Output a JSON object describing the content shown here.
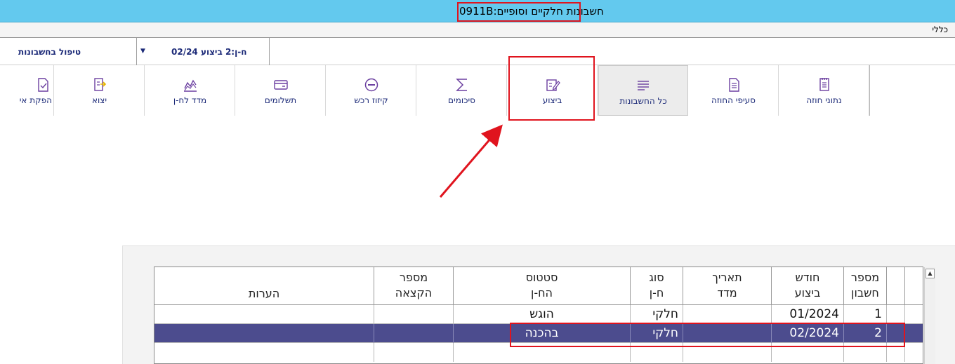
{
  "titlebar": {
    "title": "0911B:חשבונות חלקיים וסופיים"
  },
  "menu": {
    "general": "כללי"
  },
  "selector": {
    "handling_label": "טיפול בחשבונות",
    "current_value": "ח-ן:2 ביצוע 02/24"
  },
  "toolbar": {
    "buttons": [
      {
        "label": "נתוני חוזה",
        "icon": "contract-data-icon"
      },
      {
        "label": "סעיפי החוזה",
        "icon": "contract-sections-icon"
      },
      {
        "label": "כל החשבונות",
        "icon": "all-accounts-icon"
      },
      {
        "label": "ביצוע",
        "icon": "execution-icon"
      },
      {
        "label": "סיכומים",
        "icon": "sigma-icon"
      },
      {
        "label": "קיזוז רכש",
        "icon": "purchase-offset-icon"
      },
      {
        "label": "תשלומים",
        "icon": "payments-icon"
      },
      {
        "label": "מדד לח-ן",
        "icon": "index-chart-icon"
      },
      {
        "label": "יצוא",
        "icon": "export-icon"
      },
      {
        "label": "הפקת אי",
        "icon": "produce-icon"
      }
    ]
  },
  "grid": {
    "headers": {
      "account_no": "מספר\nחשבון",
      "exec_month": "חודש\nביצוע",
      "index_date": "תאריך\nמדד",
      "type": "סוג\nח-ן",
      "status": "סטטוס\nהח-ן",
      "allocation_no": "מספר\nהקצאה",
      "notes": "הערות"
    },
    "rows": [
      {
        "account_no": "1",
        "exec_month": "01/2024",
        "index_date": "",
        "type": "חלקי",
        "status": "הוגש",
        "allocation_no": "",
        "notes": ""
      },
      {
        "account_no": "2",
        "exec_month": "02/2024",
        "index_date": "",
        "type": "חלקי",
        "status": "בהכנה",
        "allocation_no": "",
        "notes": ""
      }
    ]
  },
  "colors": {
    "titlebar_bg": "#63c9ee",
    "accent_text": "#1c2a78",
    "selected_row_bg": "#4c4c8e",
    "highlight_red": "#e0141e",
    "icon_purple": "#6b3fa0"
  }
}
